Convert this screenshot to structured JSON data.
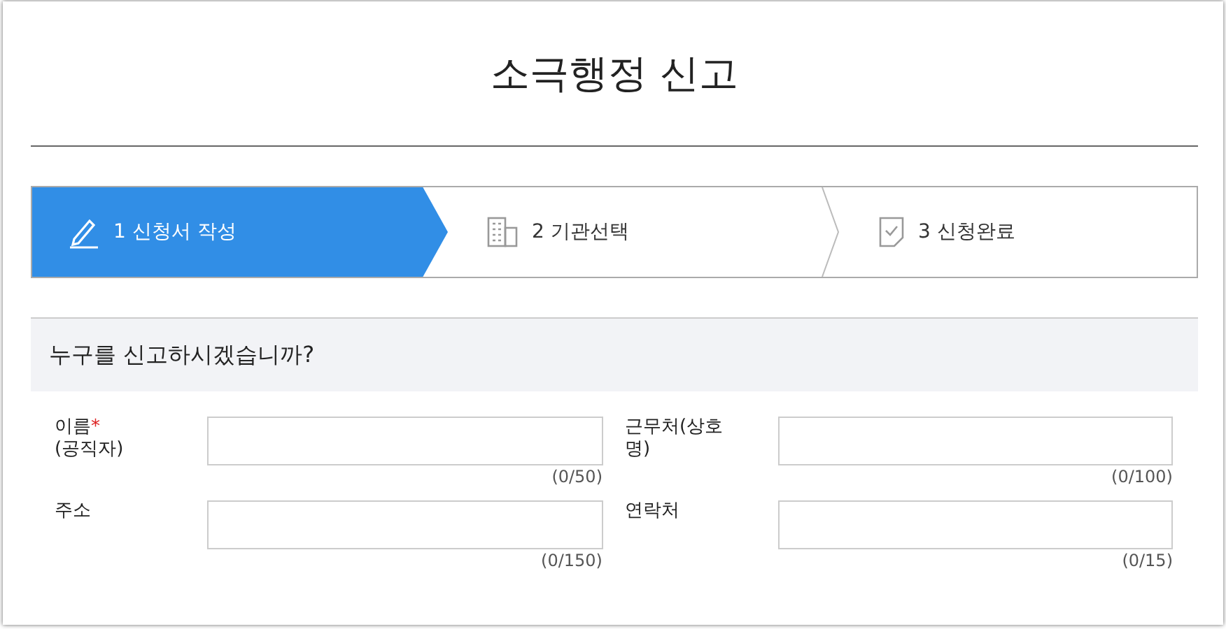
{
  "title": "소극행정 신고",
  "steps": [
    {
      "number": "1",
      "label": "신청서 작성",
      "selected": true
    },
    {
      "number": "2",
      "label": "기관선택",
      "selected": false
    },
    {
      "number": "3",
      "label": "신청완료",
      "selected": false
    }
  ],
  "section": {
    "heading": "누구를 신고하시겠습니까?"
  },
  "fields": [
    {
      "label": "이름",
      "required_mark": "*",
      "sublabel": "(공직자)",
      "counter": "(0/50)"
    },
    {
      "label": "근무처(상호명)",
      "counter": "(0/100)"
    },
    {
      "label": "주소",
      "counter": "(0/150)"
    },
    {
      "label": "연락처",
      "counter": "(0/15)"
    }
  ]
}
